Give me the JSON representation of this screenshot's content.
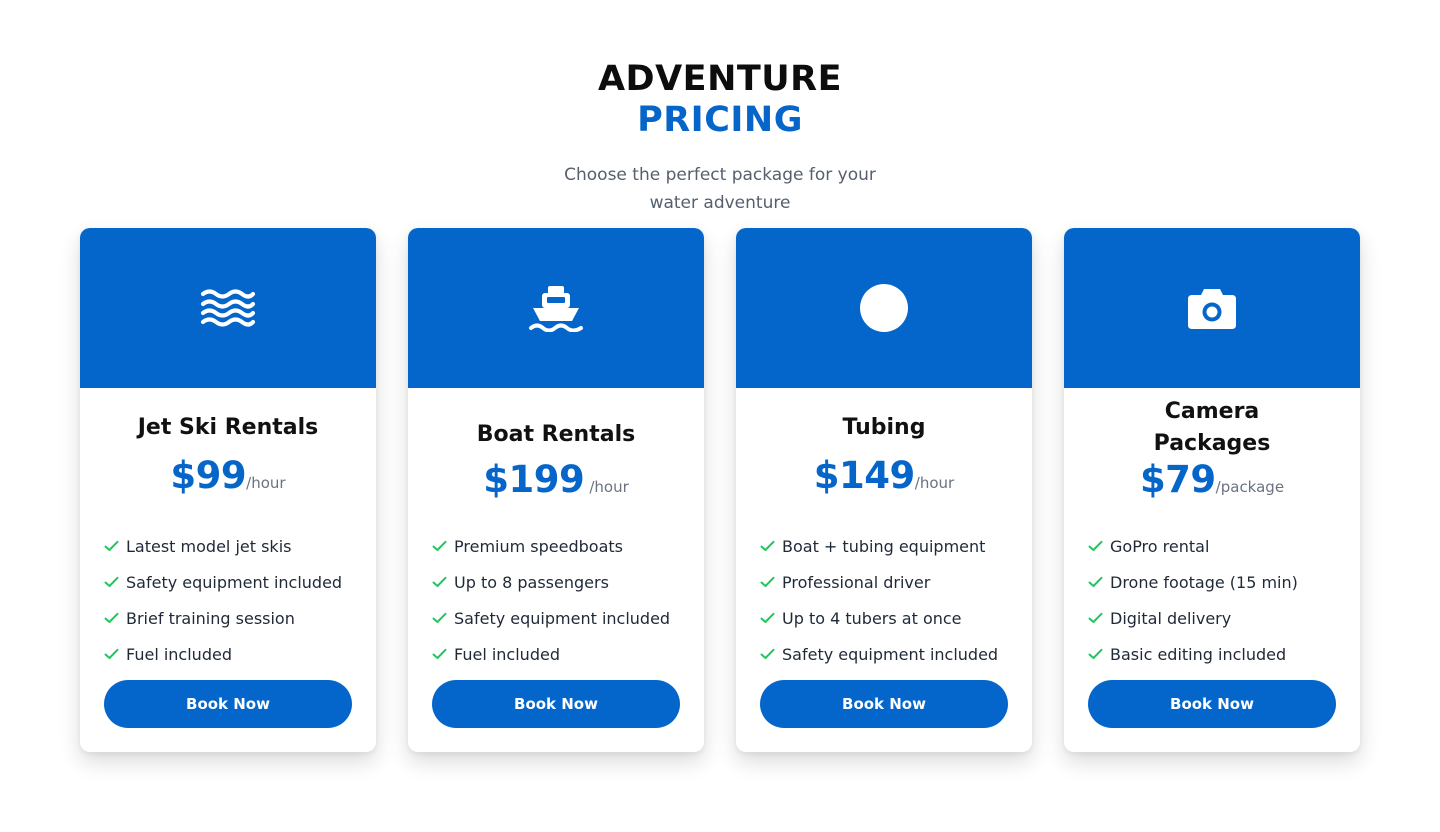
{
  "header": {
    "title_line1": "ADVENTURE",
    "title_line2": "PRICING",
    "subtitle": "Choose the perfect package for your water adventure"
  },
  "colors": {
    "brand_blue": "#0466cb",
    "check_green": "#22c55e",
    "title_dark": "#0d0d0d",
    "muted_text": "#6b7280"
  },
  "cards": [
    {
      "icon": "water-waves-icon",
      "title": "Jet Ski Rentals",
      "price": "$99",
      "per": "/hour",
      "features": [
        "Latest model jet skis",
        "Safety equipment included",
        "Brief training session",
        "Fuel included"
      ],
      "button_label": "Book Now"
    },
    {
      "icon": "ship-icon",
      "title": "Boat Rentals",
      "price": "$199",
      "per": "/hour",
      "features": [
        "Premium speedboats",
        "Up to 8 passengers",
        "Safety equipment included",
        "Fuel included"
      ],
      "button_label": "Book Now"
    },
    {
      "icon": "circle-icon",
      "title": "Tubing",
      "price": "$149",
      "per": "/hour",
      "features": [
        "Boat + tubing equipment",
        "Professional driver",
        "Up to 4 tubers at once",
        "Safety equipment included"
      ],
      "button_label": "Book Now"
    },
    {
      "icon": "camera-icon",
      "title": "Camera Packages",
      "price": "$79",
      "per": "/package",
      "features": [
        "GoPro rental",
        "Drone footage (15 min)",
        "Digital delivery",
        "Basic editing included"
      ],
      "button_label": "Book Now"
    }
  ]
}
